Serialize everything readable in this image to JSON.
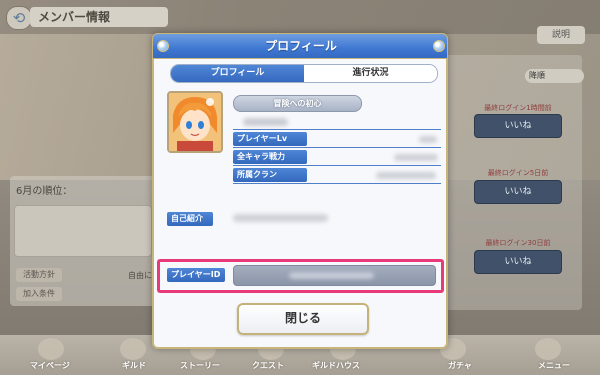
{
  "background": {
    "screen_title": "メンバー情報",
    "help_button": "説明",
    "month_rank_label": "6月の順位：",
    "activity_policy_chip": "活動方針",
    "activity_policy_text": "自由に",
    "join_condition_chip": "加入条件",
    "sort_label": "降順",
    "like_button_label": "いいね",
    "like_captions": [
      "最終ログイン1時間前",
      "最終ログイン5日前",
      "最終ログイン30日前"
    ],
    "nav_items": [
      "マイページ",
      "ギルド",
      "ストーリー",
      "クエスト",
      "ギルドハウス",
      "ガチャ",
      "メニュー"
    ]
  },
  "dialog": {
    "title": "プロフィール",
    "tabs": [
      {
        "label": "プロフィール",
        "active": true
      },
      {
        "label": "進行状況",
        "active": false
      }
    ],
    "player_title": "冒険への初心",
    "stats": [
      {
        "label": "プレイヤーLv"
      },
      {
        "label": "全キャラ戦力"
      },
      {
        "label": "所属クラン"
      }
    ],
    "self_intro_label": "自己紹介",
    "player_id_label": "プレイヤーID",
    "close_button": "閉じる"
  },
  "colors": {
    "header_blue": "#3f78d2",
    "label_blue": "#3468bd",
    "highlight": "#e83a79",
    "gold_border": "#c7b57c"
  }
}
